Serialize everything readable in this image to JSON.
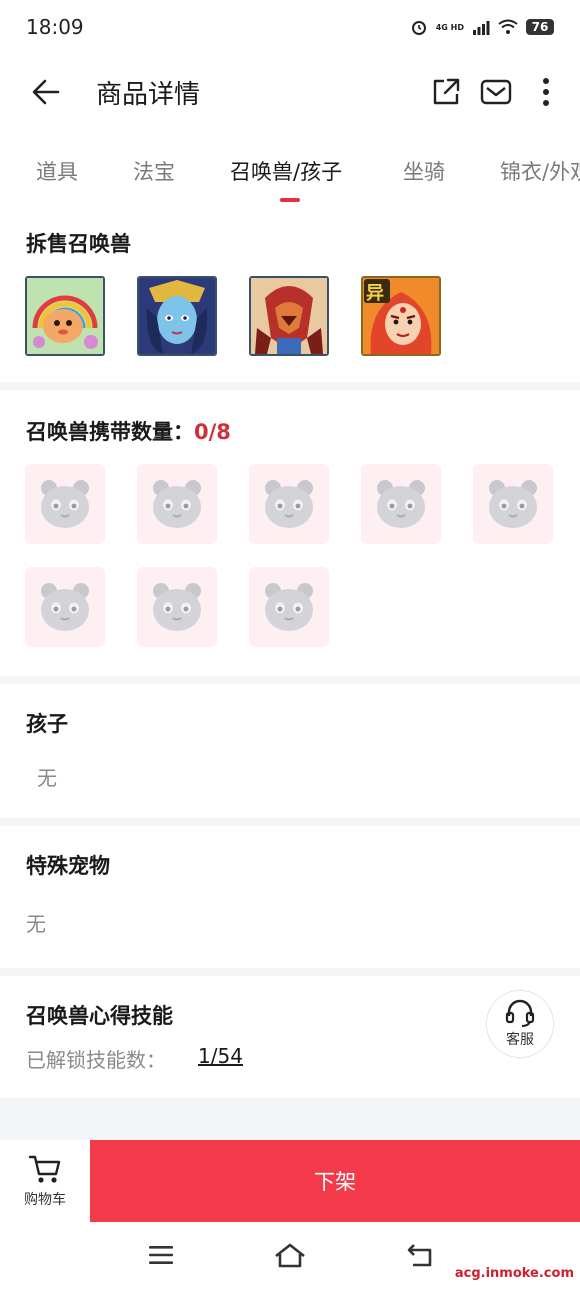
{
  "status_bar": {
    "time": "18:09",
    "network": "4G HD",
    "battery": "76"
  },
  "header": {
    "title": "商品详情",
    "icons": [
      "back-arrow-icon",
      "share-icon",
      "mail-icon",
      "more-icon"
    ]
  },
  "tabs": [
    {
      "label": "道具",
      "active": false
    },
    {
      "label": "法宝",
      "active": false
    },
    {
      "label": "召唤兽/孩子",
      "active": true
    },
    {
      "label": "坐骑",
      "active": false
    },
    {
      "label": "锦衣/外观",
      "active": false
    }
  ],
  "sold_pets": {
    "title": "拆售召唤兽",
    "items": [
      {
        "name": "pet-rainbow-creature",
        "badge": ""
      },
      {
        "name": "pet-blue-goddess",
        "badge": ""
      },
      {
        "name": "pet-red-armored-beast",
        "badge": ""
      },
      {
        "name": "pet-fire-deity",
        "badge": "异"
      }
    ]
  },
  "carry": {
    "title": "召唤兽携带数量：",
    "count": "0/8",
    "slots": 8
  },
  "children": {
    "title": "孩子",
    "value": "无"
  },
  "special_pets": {
    "title": "特殊宠物",
    "value": "无"
  },
  "skills": {
    "title": "召唤兽心得技能",
    "unlock_label": "已解锁技能数：",
    "unlock_value": "1/54"
  },
  "customer_service": {
    "label": "客服"
  },
  "bottom_bar": {
    "cart_label": "购物车",
    "action_label": "下架"
  },
  "watermark": "acg.inmoke.com",
  "colors": {
    "accent": "#e4313c",
    "action": "#f23a4a",
    "slot_bg": "#fdeff2"
  }
}
